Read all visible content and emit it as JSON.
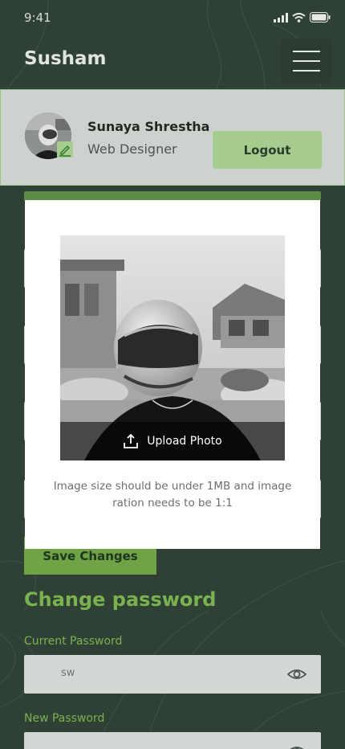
{
  "status": {
    "time": "9:41"
  },
  "header": {
    "brand": "Susham"
  },
  "profile": {
    "name": "Sunaya Shrestha",
    "role": "Web Designer",
    "logout_label": "Logout"
  },
  "modal": {
    "upload_label": "Upload Photo",
    "note": "Image size should be under 1MB and image ration needs to be 1:1"
  },
  "form": {
    "save_label": "Save Changes"
  },
  "password": {
    "title": "Change password",
    "current_label": "Current Password",
    "current_value": "sw",
    "new_label": "New Password"
  },
  "colors": {
    "background": "#2f4035",
    "accent": "#7ab24f",
    "logout": "#a6cd8f",
    "save": "#6ea346",
    "card": "#cdd2cf"
  },
  "icons": [
    "signal-icon",
    "wifi-icon",
    "battery-icon",
    "menu-icon",
    "edit-icon",
    "upload-icon",
    "eye-icon"
  ]
}
